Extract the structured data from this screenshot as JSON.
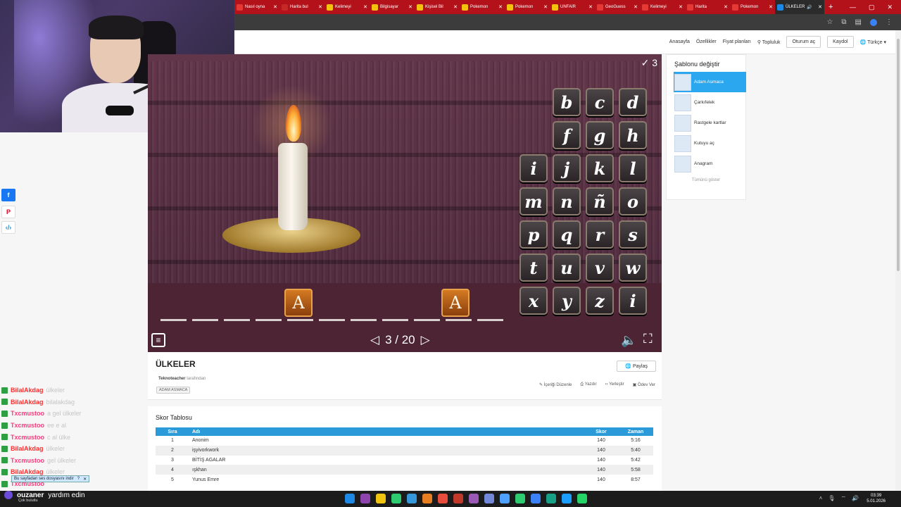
{
  "browser": {
    "tabs": [
      {
        "label": "Nasıl oyna",
        "color": "#e53935"
      },
      {
        "label": "Harita bul",
        "color": "#c62828"
      },
      {
        "label": "Kelimeyi",
        "color": "#f4c20d"
      },
      {
        "label": "Bilgisayar",
        "color": "#f4c20d"
      },
      {
        "label": "Kişisel Bil",
        "color": "#f4c20d"
      },
      {
        "label": "Pokemon",
        "color": "#f4c20d"
      },
      {
        "label": "Pokemon",
        "color": "#f4c20d"
      },
      {
        "label": "UNFAIR",
        "color": "#f4c20d"
      },
      {
        "label": "GeoGuess",
        "color": "#e53935"
      },
      {
        "label": "Kelimeyi",
        "color": "#e53935"
      },
      {
        "label": "Harita",
        "color": "#e53935"
      },
      {
        "label": "Pokemon",
        "color": "#e53935"
      }
    ],
    "active_tab": "ÜLKELER",
    "new_tab": "+",
    "win_min": "—",
    "win_max": "▢",
    "win_close": "✕"
  },
  "nav": {
    "home": "Anasayfa",
    "features": "Özellikler",
    "pricing": "Fiyat planları",
    "community": "Topluluk",
    "login": "Oturum aç",
    "signup": "Kaydol",
    "language": "Türkçe"
  },
  "game": {
    "score": "3",
    "letters": [
      "b",
      "c",
      "d",
      "f",
      "g",
      "h",
      "i",
      "j",
      "k",
      "l",
      "m",
      "n",
      "ñ",
      "o",
      "p",
      "q",
      "r",
      "s",
      "t",
      "u",
      "v",
      "w",
      "x",
      "y",
      "z",
      "i"
    ],
    "revealed": [
      {
        "letter": "A"
      },
      {
        "letter": "A"
      }
    ],
    "page": "3 / 20"
  },
  "templates": {
    "title": "Şablonu değiştir",
    "items": [
      "Adam Asmaca",
      "Çarkıfelek",
      "Rastgele kartlar",
      "Kutuyu aç",
      "Anagram"
    ],
    "more": "Tümünü göster"
  },
  "activity": {
    "title": "ÜLKELER",
    "author": "Teknoteacher",
    "author_suffix": "tarafından",
    "tag": "ADAM ASMACA",
    "share": "Paylaş",
    "actions": [
      "İçeriği Düzenle",
      "Yazdır",
      "Yerleştir",
      "Ödev Ver"
    ]
  },
  "leaderboard": {
    "title": "Skor Tablosu",
    "headers": [
      "Sıra",
      "Adı",
      "Skor",
      "Zaman"
    ],
    "rows": [
      [
        "1",
        "Anonim",
        "140",
        "5:16"
      ],
      [
        "2",
        "işyivorkwork",
        "140",
        "5:40"
      ],
      [
        "3",
        "BİTİŞ AGALAR",
        "140",
        "5:42"
      ],
      [
        "4",
        "ışkhan",
        "140",
        "5:58"
      ],
      [
        "5",
        "Yunus Emre",
        "140",
        "8:57"
      ]
    ]
  },
  "chat": [
    {
      "user": "BilalAkdag",
      "msg": "ülkeler"
    },
    {
      "user": "BilalAkdag",
      "msg": "bilalakdag"
    },
    {
      "user": "Txcmustoo",
      "msg": "a gel ülkeler"
    },
    {
      "user": "Txcmustoo",
      "msg": "ee e al"
    },
    {
      "user": "Txcmustoo",
      "msg": "c al ülke"
    },
    {
      "user": "BilalAkdag",
      "msg": "ülkeler"
    },
    {
      "user": "Txcmustoo",
      "msg": "gel ülkeler"
    },
    {
      "user": "BilalAkdag",
      "msg": "ülkeler"
    },
    {
      "user": "Txcmustoo",
      "msg": ""
    }
  ],
  "download_bar": "Bu sayfadan ses dosyasını indir",
  "stream": {
    "name": "ouzaner",
    "message": "yardım edin",
    "sub": "Çok bulutlu"
  },
  "clock": {
    "time": "03:39",
    "date": "5.01.2026"
  }
}
